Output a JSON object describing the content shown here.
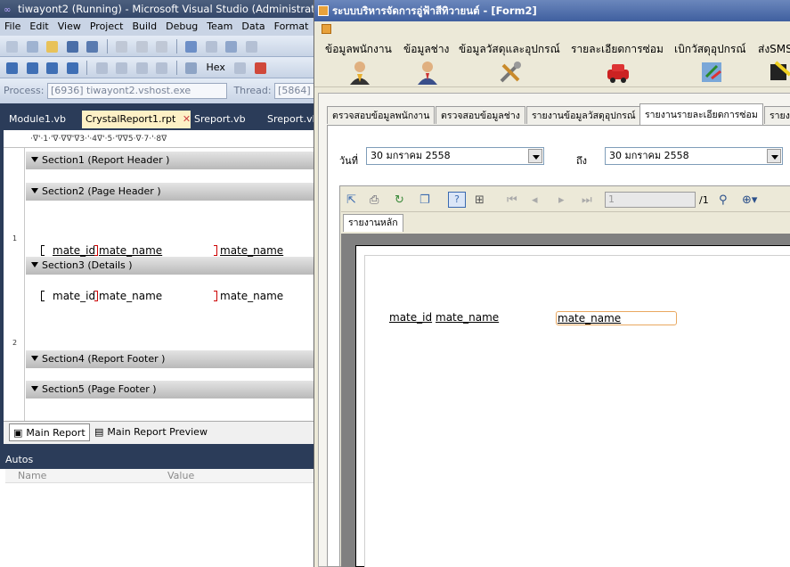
{
  "vs": {
    "title": "tiwayont2 (Running) - Microsoft Visual Studio (Administrat",
    "menu": [
      "File",
      "Edit",
      "View",
      "Project",
      "Build",
      "Debug",
      "Team",
      "Data",
      "Format"
    ],
    "hex_label": "Hex",
    "process_label": "Process:",
    "process_value": "[6936] tiwayont2.vshost.exe",
    "thread_label": "Thread:",
    "thread_value": "[5864]",
    "tabs": [
      "Module1.vb",
      "CrystalReport1.rpt",
      "Sreport.vb",
      "Sreport.vb"
    ],
    "tab_close": "✕",
    "ruler": "·ᐁ'·1·'ᐁ·ᐁᐁ'ᐁ3·'·4ᐁ'·5·'ᐁᐁ5·ᐁ·7·'·8ᐁ",
    "sections": [
      "Section1 (Report Header )",
      "Section2 (Page Header )",
      "Section3 (Details )",
      "Section4 (Report Footer )",
      "Section5 (Page Footer )"
    ],
    "fields": {
      "id": "mate_id",
      "name": "mate_name",
      "name2": "mate_name"
    },
    "ruler_marks": {
      "m1": "1",
      "m2": "2"
    },
    "report_tabs": [
      "Main Report",
      "Main Report Preview"
    ],
    "autos": {
      "title": "Autos",
      "col_name": "Name",
      "col_value": "Value"
    }
  },
  "form": {
    "title": "ระบบบริหารจัดการอู่ฟ้าสีทิวายนต์ - [Form2]",
    "menu": [
      "ข้อมูลพนักงาน",
      "ข้อมูลช่าง",
      "ข้อมูลวัสดุและอุปกรณ์",
      "รายละเอียดการซ่อม",
      "เบิกวัสดุอุปกรณ์",
      "ส่งSMS"
    ],
    "tabs": [
      "ตรวจสอบข้อมูลพนักงาน",
      "ตรวจสอบข้อมูลช่าง",
      "รายงานข้อมูลวัสดุอุปกรณ์",
      "รายงานรายละเอียดการซ่อม",
      "รายง"
    ],
    "date_label": "วันที่",
    "to_label": "ถึง",
    "date_from": "30  มกราคม    2558",
    "date_to": "30  มกราคม    2558",
    "page_input": "1",
    "page_total": "/1",
    "viewer_tab": "รายงานหลัก",
    "preview": {
      "id": "mate_id",
      "name": "mate_name",
      "name2": "mate_name"
    }
  },
  "colors": {
    "vs_chrome": "#2b3c59",
    "active_tab": "#fdf1c6",
    "form_title": "#3f5f9f"
  }
}
